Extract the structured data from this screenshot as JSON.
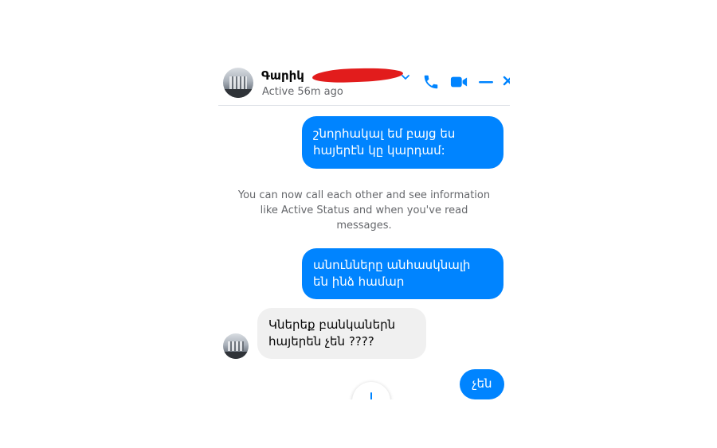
{
  "header": {
    "contact_name": "Գարիկ",
    "status": "Active 56m ago",
    "icons": [
      "chevron-down-icon",
      "phone-icon",
      "video-icon",
      "minimize-icon",
      "close-icon"
    ]
  },
  "messages": [
    {
      "direction": "outgoing",
      "text": "շնորհակալ եմ բայց ես\nհայերէն կը կարդամ:"
    },
    {
      "direction": "outgoing",
      "text": "անունները անհասկնալի\nեն ինձ համար"
    },
    {
      "direction": "incoming",
      "text": "Կներեք բանկաներն\nհայերեն չեն ????"
    },
    {
      "direction": "outgoing",
      "text": "չեն"
    }
  ],
  "system_note": "You can now call each other and see information\nlike Active Status and when you've read\nmessages.",
  "colors": {
    "outgoing_bubble": "#0084ff",
    "incoming_bubble": "#f0f0f0",
    "accent": "#0084ff",
    "redaction": "#e21c1c"
  }
}
